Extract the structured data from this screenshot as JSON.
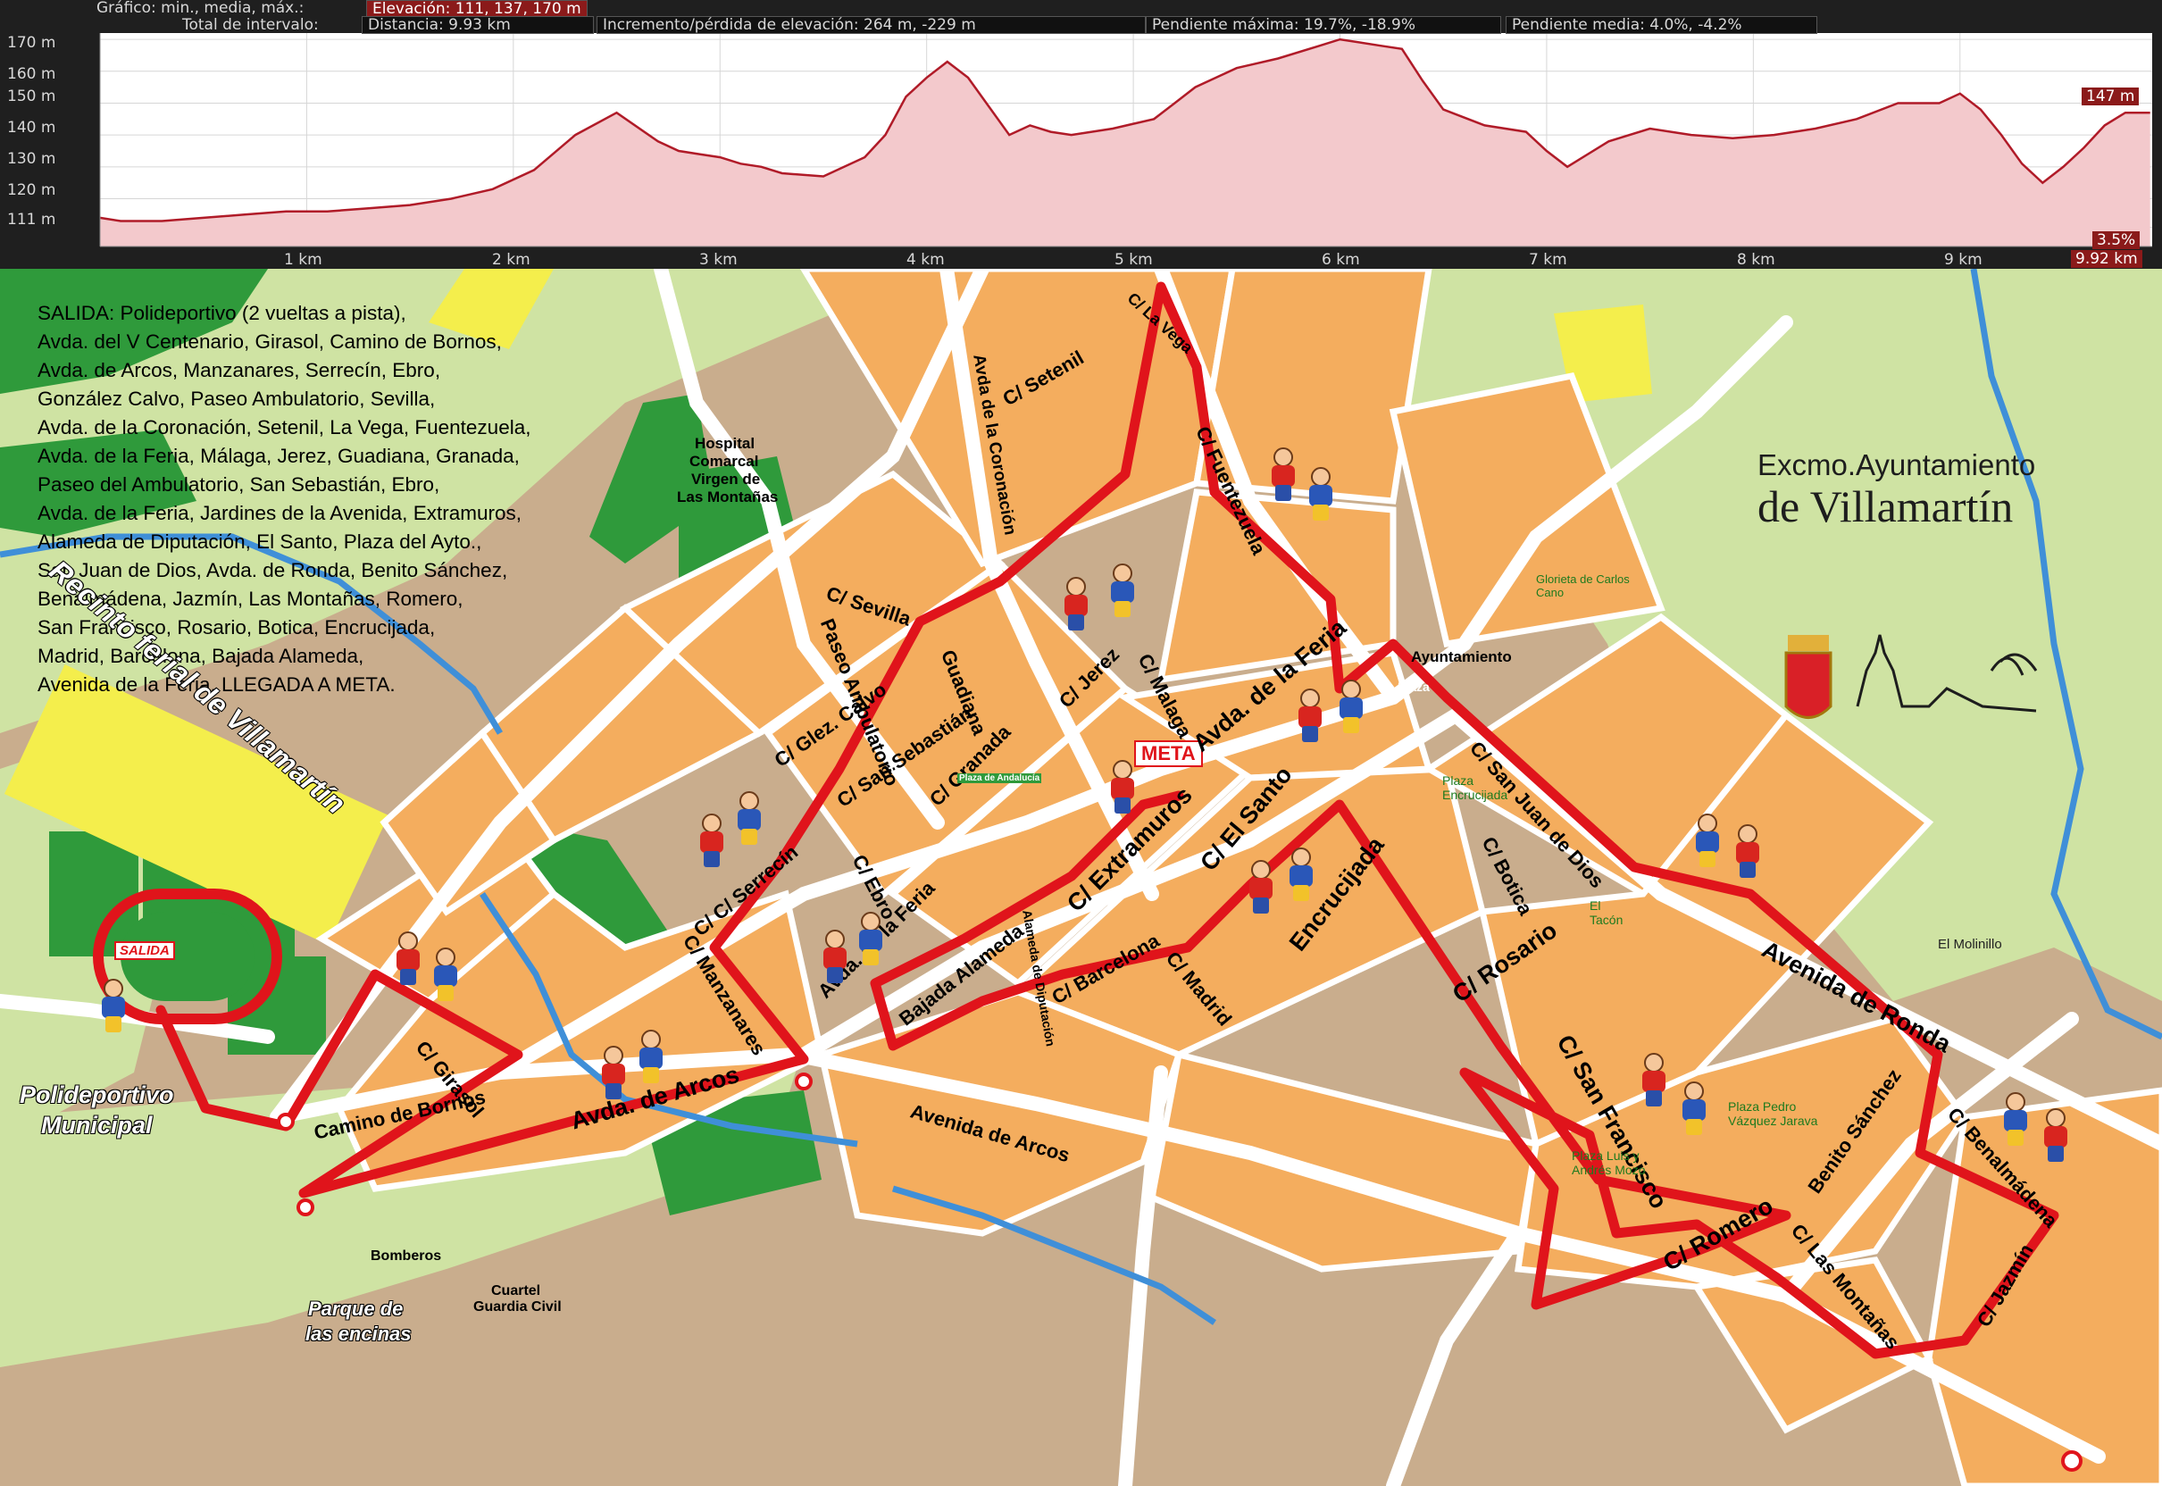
{
  "profile": {
    "graph_label": "Gráfico: min., media, máx.:",
    "elevation_stats": "Elevación: 111, 137, 170 m",
    "interval_label": "Total de intervalo:",
    "distance": "Distancia: 9.93 km",
    "gain_loss": "Incremento/pérdida de elevación: 264 m, -229 m",
    "max_slope": "Pendiente máxima: 19.7%, -18.9%",
    "avg_slope": "Pendiente media: 4.0%, -4.2%",
    "y_ticks": [
      "170 m",
      "160 m",
      "150 m",
      "140 m",
      "130 m",
      "120 m",
      "111 m"
    ],
    "x_ticks": [
      "1 km",
      "2 km",
      "3 km",
      "4 km",
      "5 km",
      "6 km",
      "7 km",
      "8 km",
      "9 km"
    ],
    "current_elevation": "147 m",
    "current_slope": "3.5%",
    "current_distance": "9.92 km",
    "colors": {
      "fill": "#f3c9cc",
      "line": "#b01b28",
      "badge": "#8b1a1a",
      "background": "#1f1f1f"
    }
  },
  "chart_data": {
    "type": "area",
    "x": [
      0,
      0.1,
      0.3,
      0.5,
      0.7,
      0.9,
      1.1,
      1.3,
      1.5,
      1.7,
      1.9,
      2.1,
      2.3,
      2.5,
      2.7,
      2.8,
      2.9,
      3.0,
      3.1,
      3.2,
      3.3,
      3.5,
      3.7,
      3.8,
      3.9,
      4.0,
      4.1,
      4.2,
      4.3,
      4.4,
      4.5,
      4.6,
      4.7,
      4.9,
      5.1,
      5.2,
      5.3,
      5.4,
      5.5,
      5.7,
      5.9,
      6.0,
      6.2,
      6.3,
      6.4,
      6.5,
      6.7,
      6.9,
      7.0,
      7.1,
      7.3,
      7.5,
      7.7,
      7.9,
      8.1,
      8.3,
      8.5,
      8.7,
      8.9,
      9.0,
      9.1,
      9.2,
      9.3,
      9.4,
      9.5,
      9.6,
      9.7,
      9.8,
      9.92
    ],
    "y": [
      114,
      113,
      113,
      114,
      115,
      116,
      116,
      117,
      118,
      120,
      123,
      129,
      140,
      147,
      138,
      135,
      134,
      133,
      131,
      130,
      128,
      127,
      133,
      140,
      152,
      158,
      163,
      158,
      149,
      140,
      143,
      141,
      140,
      142,
      145,
      150,
      155,
      158,
      161,
      164,
      168,
      170,
      168,
      167,
      157,
      148,
      143,
      141,
      135,
      130,
      138,
      142,
      140,
      139,
      140,
      142,
      145,
      150,
      150,
      153,
      148,
      140,
      131,
      125,
      130,
      136,
      143,
      147,
      147
    ],
    "xlabel": "",
    "ylabel": "",
    "ylim": [
      105,
      172
    ],
    "xlim": [
      0,
      9.93
    ],
    "grid": true
  },
  "map": {
    "itinerary": [
      "SALIDA: Polideportivo (2 vueltas a pista),",
      "Avda. del V Centenario, Girasol, Camino de Bornos,",
      "Avda. de Arcos, Manzanares, Serrecín, Ebro,",
      "González Calvo, Paseo Ambulatorio, Sevilla,",
      "Avda. de la Coronación, Setenil, La Vega, Fuentezuela,",
      "Avda. de la Feria, Málaga, Jerez, Guadiana, Granada,",
      "Paseo del Ambulatorio, San Sebastián, Ebro,",
      "Avda. de la Feria, Jardines de la Avenida, Extramuros,",
      "Alameda de Diputación, El Santo, Plaza del Ayto.,",
      "San Juan de Dios, Avda. de Ronda, Benito Sánchez,",
      "Benalmádena, Jazmín, Las Montañas, Romero,",
      "San Francisco, Rosario, Botica, Encrucijada,",
      "Madrid, Barcelona, Bajada Alameda,",
      "Avenida de la Feria, LLEGADA A META."
    ],
    "logo": {
      "line1": "Excmo.Ayuntamiento",
      "line2": "de Villamartín"
    },
    "labels": {
      "recinto": "Recinto ferial de Villamartín",
      "polideportivo_1": "Polideportivo",
      "polideportivo_2": "Municipal",
      "salida": "SALIDA",
      "meta": "META",
      "hospital_1": "Hospital",
      "hospital_2": "Comarcal",
      "hospital_3": "Virgen de",
      "hospital_4": "Las Montañas",
      "girasol": "C/ Girasol",
      "camino_bornos": "Camino de Bornos",
      "avda_arcos": "Avda. de Arcos",
      "avenida_arcos": "Avenida de Arcos",
      "manzanares": "C/ Manzanares",
      "serrecin": "C/ C/ Serrecín",
      "ebro": "C/ Ebro",
      "gonzalez_calvo": "C/ Glez. Calvo",
      "san_sebastian": "C/ San Sebastián",
      "granada": "C/ Granada",
      "paseo_ambulatorio": "Paseo Ambulatorio",
      "guadiana": "Guadiana",
      "sevilla": "C/ Sevilla",
      "coronacion": "Avda de la Coronación",
      "setenil": "C/ Setenil",
      "la_vega": "C/ La Vega",
      "fuentezuela": "C/ Fuentezuela",
      "jerez": "C/ Jerez",
      "malaga": "C/ Malaga",
      "avda_feria_n": "Avda. de la Feria",
      "avda_feria_s": "Avda. de la Feria",
      "extramuros": "C/ Extramuros",
      "el_santo": "C/ El Santo",
      "alameda_diputacion": "Alameda de Diputación",
      "bajada_alameda": "Bajada Alameda",
      "barcelona": "C/ Barcelona",
      "madrid": "C/ Madrid",
      "encrucijada": "Encrucijada",
      "botica": "C/ Botica",
      "rosario": "C/ Rosario",
      "san_francisco": "C/ San Francisco",
      "san_juan_dios": "C/ San Juan de Dios",
      "ayuntamiento": "Ayuntamiento",
      "plaza": "Plaza",
      "plaza_encrucijada": "Plaza Encrucijada",
      "el_tacon": "El Tacón",
      "glorieta": "Glorieta de Carlos Cano",
      "avenida_ronda": "Avenida de Ronda",
      "molinillo": "El Molinillo",
      "benito_sanchez": "Benito Sánchez",
      "benalmadena": "C/ Benalmádena",
      "jazmin": "C/ Jazmín",
      "las_montanas": "C/ Las Montañas",
      "romero": "C/ Romero",
      "plaza_pedro": "Plaza Pedro Vázquez Jarava",
      "plaza_luis": "Plaza Luis y Andrés Mozo",
      "bomberos": "Bomberos",
      "cuartel_1": "Cuartel",
      "cuartel_2": "Guardia Civil",
      "parque_1": "Parque de",
      "parque_2": "las encinas",
      "plaza_andalucia": "Plaza de Andalucía"
    },
    "colors": {
      "route": "#e0141b",
      "block": "#f4ad5e",
      "road": "#ffffff",
      "park": "#2f9a3b",
      "grass": "#cfe3a3",
      "water": "#3f8fd8",
      "ground": "#c9ad8d"
    }
  }
}
